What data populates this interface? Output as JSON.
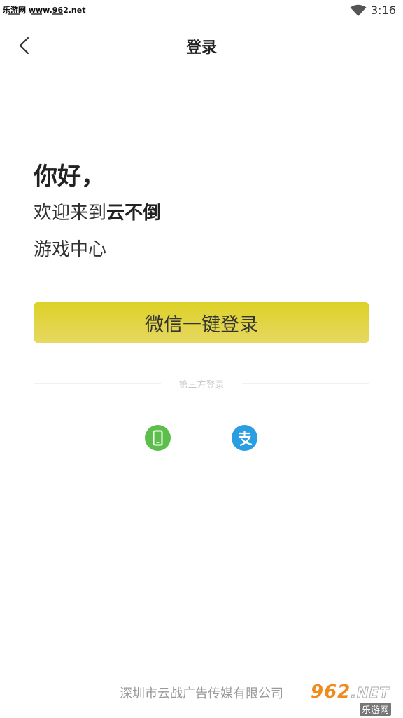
{
  "status_bar": {
    "watermark": "乐游网 www.962.net",
    "time": "3:16"
  },
  "nav": {
    "title": "登录"
  },
  "greeting": {
    "hello": "你好，",
    "welcome_prefix": "欢迎来到",
    "brand": "云不倒",
    "center": "游戏中心"
  },
  "wechat_button": {
    "label": "微信一键登录",
    "color": "#ddd126"
  },
  "third_party": {
    "label": "第三方登录",
    "phone_color": "#5cbf4b",
    "alipay_color": "#2a9ee3",
    "icons": [
      "phone-icon",
      "alipay-icon"
    ]
  },
  "footer": {
    "company": "深圳市云战广告传媒有限公司"
  },
  "watermark_bottom": {
    "logo": "962",
    "logo_suffix": ".NET",
    "site_name": "乐游网"
  }
}
